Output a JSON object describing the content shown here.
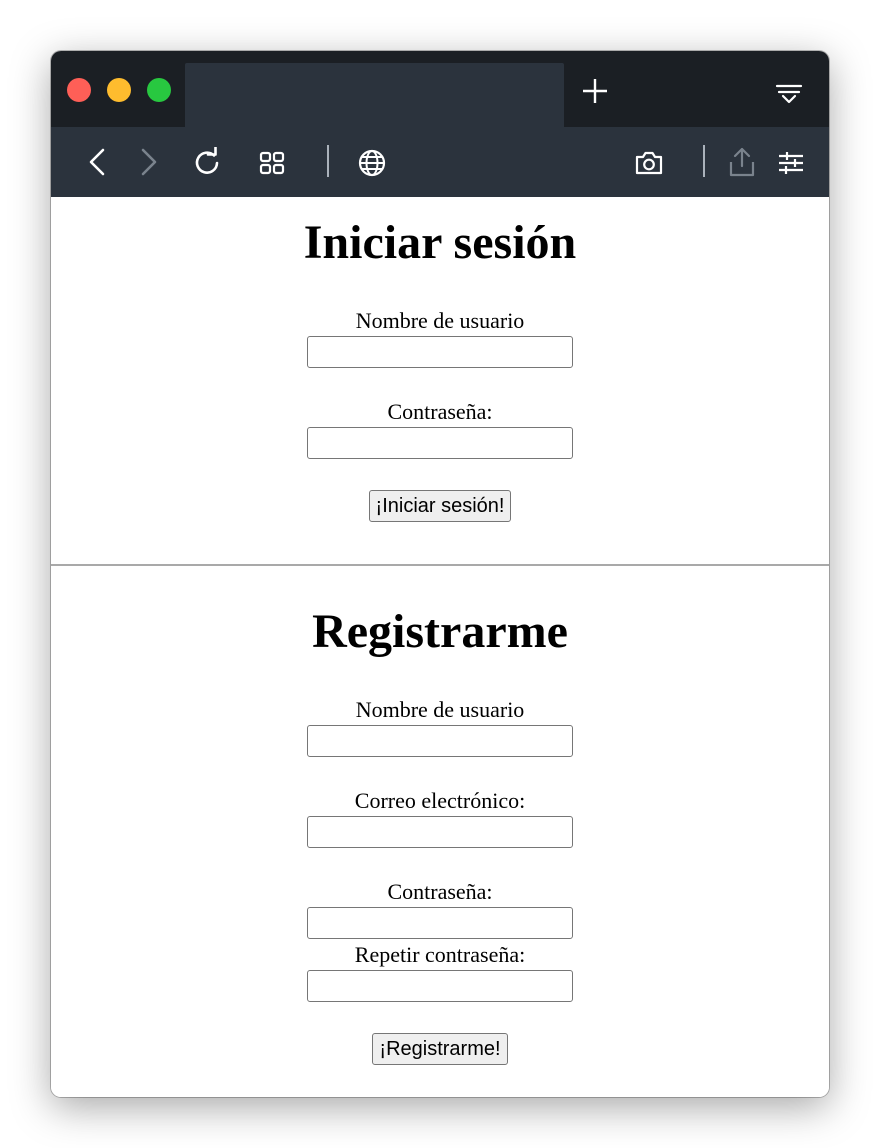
{
  "browser": {
    "new_tab_symbol": "+",
    "icons": [
      "back-icon",
      "forward-icon",
      "reload-icon",
      "tabs-grid-icon",
      "globe-icon",
      "camera-icon",
      "share-icon",
      "settings-sliders-icon",
      "tab-list-icon"
    ]
  },
  "login": {
    "title": "Iniciar sesión",
    "username_label": "Nombre de usuario",
    "username_value": "",
    "password_label": "Contraseña:",
    "password_value": "",
    "submit_label": "¡Iniciar sesión!"
  },
  "register": {
    "title": "Registrarme",
    "username_label": "Nombre de usuario",
    "username_value": "",
    "email_label": "Correo electrónico:",
    "email_value": "",
    "password_label": "Contraseña:",
    "password_value": "",
    "repeat_password_label": "Repetir contraseña:",
    "repeat_password_value": "",
    "submit_label": "¡Registrarme!"
  },
  "colors": {
    "tabbar": "#1b1f24",
    "toolbar": "#2b333d",
    "close": "#fe5f57",
    "minimize": "#febc2e",
    "zoom": "#28c840"
  }
}
